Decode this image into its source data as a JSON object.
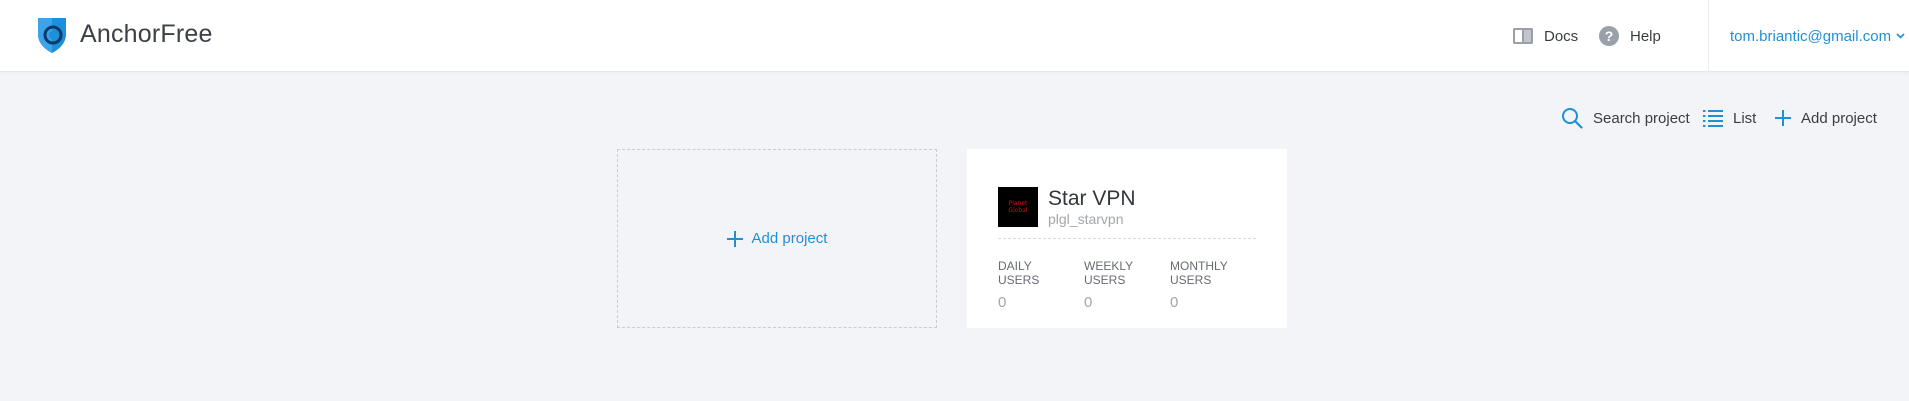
{
  "colors": {
    "accent": "#1e90d8",
    "background": "#f3f4f7",
    "logo": "#1e8fd9"
  },
  "header": {
    "brand": "AnchorFree",
    "logo_icon": "shield-icon",
    "nav": [
      {
        "label": "Docs",
        "icon": "book-icon"
      },
      {
        "label": "Help",
        "icon": "question-circle-icon"
      }
    ],
    "user_email": "tom.briantic@gmail.com",
    "user_menu_icon": "chevron-down-icon"
  },
  "toolbar": {
    "search_label": "Search project",
    "list_label": "List",
    "add_label": "Add project"
  },
  "add_card": {
    "label": "Add project",
    "icon": "plus-icon"
  },
  "projects": [
    {
      "name": "Star VPN",
      "id": "plgl_starvpn",
      "thumbnail_text": [
        "Planet",
        "Global"
      ],
      "stats": [
        {
          "label": "DAILY\nUSERS",
          "value": "0"
        },
        {
          "label": "WEEKLY\nUSERS",
          "value": "0"
        },
        {
          "label": "MONTHLY\nUSERS",
          "value": "0"
        }
      ]
    }
  ]
}
